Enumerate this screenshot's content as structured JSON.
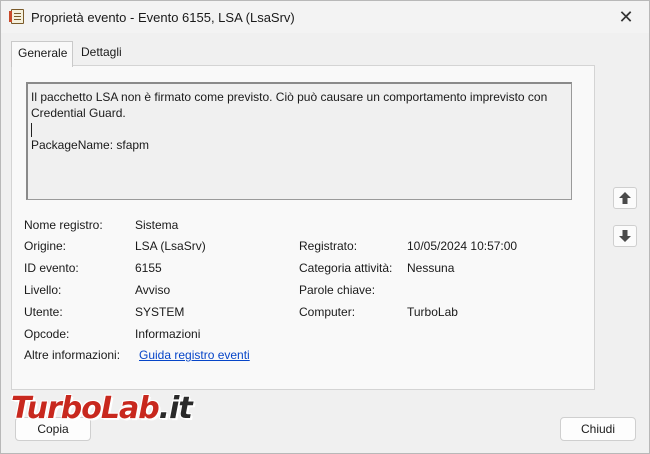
{
  "window": {
    "title": "Proprietà evento - Evento 6155, LSA (LsaSrv)",
    "close_glyph": "✕"
  },
  "tabs": [
    {
      "label": "Generale",
      "active": true
    },
    {
      "label": "Dettagli",
      "active": false
    }
  ],
  "description": {
    "line1": "Il pacchetto LSA non è firmato come previsto. Ciò può causare un comportamento imprevisto con",
    "line2": "Credential Guard.",
    "line3": "PackageName: sfapm"
  },
  "fields": {
    "nome_registro": {
      "label": "Nome registro:",
      "value": "Sistema"
    },
    "origine": {
      "label": "Origine:",
      "value": "LSA (LsaSrv)"
    },
    "registrato": {
      "label": "Registrato:",
      "value": "10/05/2024 10:57:00"
    },
    "id_evento": {
      "label": "ID evento:",
      "value": "6155"
    },
    "categoria": {
      "label": "Categoria attività:",
      "value": "Nessuna"
    },
    "livello": {
      "label": "Livello:",
      "value": "Avviso"
    },
    "parole_chiave": {
      "label": "Parole chiave:",
      "value": ""
    },
    "utente": {
      "label": "Utente:",
      "value": "SYSTEM"
    },
    "computer": {
      "label": "Computer:",
      "value": "TurboLab"
    },
    "opcode": {
      "label": "Opcode:",
      "value": "Informazioni"
    },
    "altre_info": {
      "label": "Altre informazioni:",
      "link": "Guida registro eventi"
    }
  },
  "nav": {
    "up_icon": "arrow-up-icon",
    "down_icon": "arrow-down-icon"
  },
  "buttons": {
    "copy": "Copia",
    "close": "Chiudi"
  },
  "watermark": {
    "text_a": "TurboLab",
    "text_b": ".it"
  }
}
